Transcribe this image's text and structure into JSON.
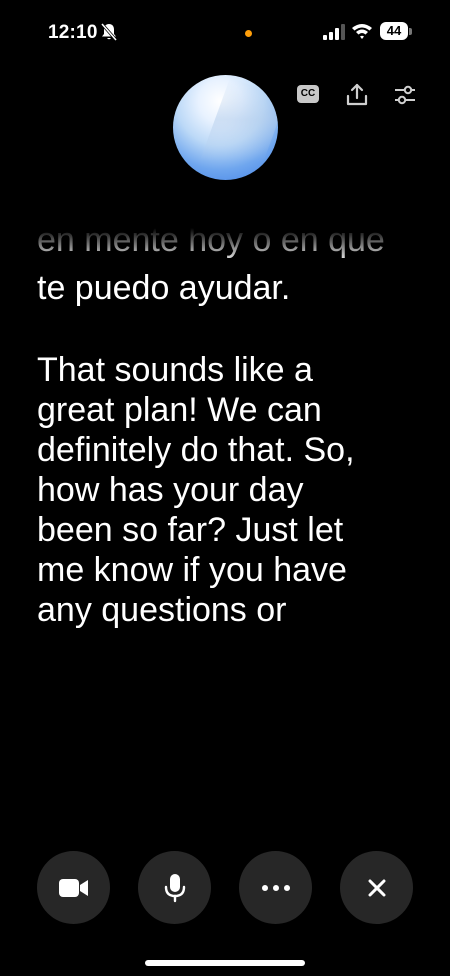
{
  "status_bar": {
    "time": "12:10",
    "battery": "44",
    "icons": [
      "bell-slash-icon",
      "signal-icon",
      "wifi-icon",
      "battery-icon"
    ],
    "indicator_color": "#ff9f0a"
  },
  "toolbar": {
    "cc_label": "CC",
    "icons": [
      "closed-captions-icon",
      "share-icon",
      "settings-sliders-icon"
    ]
  },
  "transcript": {
    "faded_line": "en mente hoy o en que",
    "first_tail": "te puedo ayudar.",
    "reply_lines": [
      "That sounds like a",
      "great plan! We can",
      "definitely do that. So,",
      "how has your day",
      "been so far? Just let",
      "me know if you have",
      "any questions or"
    ]
  },
  "controls": {
    "icons": [
      "video-camera-icon",
      "microphone-icon",
      "more-icon",
      "close-icon"
    ],
    "background": "#272727"
  }
}
